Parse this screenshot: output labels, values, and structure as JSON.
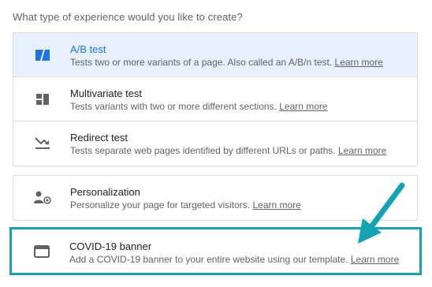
{
  "prompt": "What type of experience would you like to create?",
  "options": [
    {
      "title": "A/B test",
      "desc": "Tests two or more variants of a page. Also called an A/B/n test.",
      "link": "Learn more",
      "icon": "ab-test-icon"
    },
    {
      "title": "Multivariate test",
      "desc": "Tests variants with two or more different sections.",
      "link": "Learn more",
      "icon": "multivariate-icon"
    },
    {
      "title": "Redirect test",
      "desc": "Tests separate web pages identified by different URLs or paths.",
      "link": "Learn more",
      "icon": "redirect-icon"
    },
    {
      "title": "Personalization",
      "desc": "Personalize your page for targeted visitors.",
      "link": "Learn more",
      "icon": "personalization-icon"
    },
    {
      "title": "COVID-19 banner",
      "desc": "Add a COVID-19 banner to your entire website using our template.",
      "link": "Learn more",
      "icon": "banner-icon"
    }
  ],
  "colors": {
    "accent": "#1a73e8",
    "selected_bg": "#e8f0fe",
    "highlight": "#12a4b4",
    "icon": "#5f6368"
  }
}
